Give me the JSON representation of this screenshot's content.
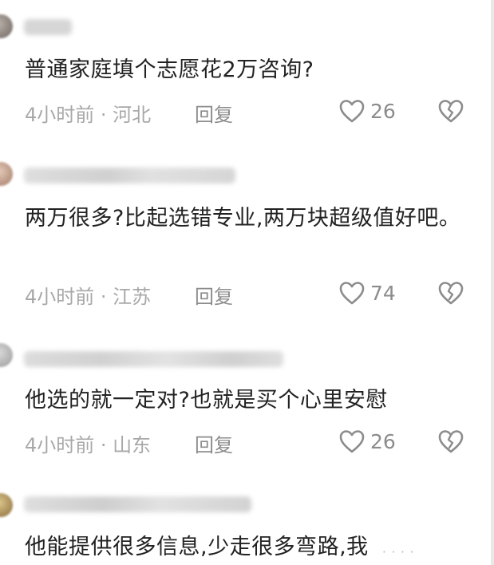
{
  "comments": [
    {
      "text": "普通家庭填个志愿花2万咨询?",
      "time_location": "4小时前 · 河北",
      "reply_label": "回复",
      "likes": "26"
    },
    {
      "text": "两万很多?比起选错专业,两万块超级值好吧。",
      "time_location": "4小时前 · 江苏",
      "reply_label": "回复",
      "likes": "74"
    },
    {
      "text": "他选的就一定对?也就是买个心里安慰",
      "time_location": "4小时前 · 山东",
      "reply_label": "回复",
      "likes": "26"
    },
    {
      "text": "他能提供很多信息,少走很多弯路,我"
    }
  ],
  "icons": {
    "like": "heart-outline-icon",
    "dislike": "broken-heart-icon"
  },
  "colors": {
    "text": "#222222",
    "meta": "#a8a8a8",
    "action": "#8c8c8c"
  }
}
